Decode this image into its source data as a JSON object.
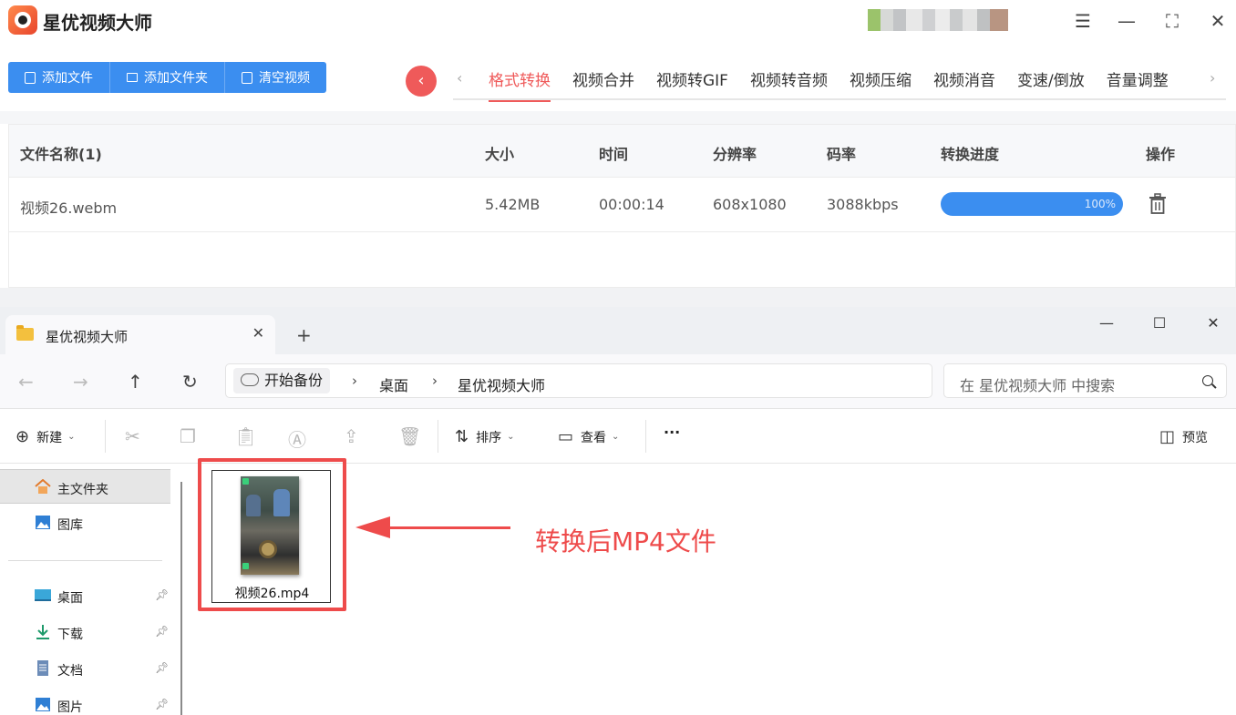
{
  "app": {
    "title": "星优视频大师",
    "window_controls": {
      "menu": "☰",
      "minimize": "—",
      "maximize": "⛶",
      "close": "✕"
    },
    "toolbar": {
      "add_file": "添加文件",
      "add_folder": "添加文件夹",
      "clear": "清空视频"
    },
    "back_glyph": "‹",
    "tabs": [
      {
        "label": "格式转换",
        "active": true
      },
      {
        "label": "视频合并"
      },
      {
        "label": "视频转GIF"
      },
      {
        "label": "视频转音频"
      },
      {
        "label": "视频压缩"
      },
      {
        "label": "视频消音"
      },
      {
        "label": "变速/倒放"
      },
      {
        "label": "音量调整"
      }
    ],
    "table": {
      "headers": [
        "文件名称(1)",
        "大小",
        "时间",
        "分辨率",
        "码率",
        "转换进度",
        "操作"
      ],
      "rows": [
        {
          "name": "视频26.webm",
          "size": "5.42MB",
          "duration": "00:00:14",
          "resolution": "608x1080",
          "bitrate": "3088kbps",
          "progress": 100,
          "progress_label": "100%"
        }
      ]
    },
    "colors": {
      "accent": "#3b8ef0",
      "active_tab": "#ef5a5a"
    }
  },
  "explorer": {
    "tab_title": "星优视频大师",
    "tab_close": "✕",
    "new_tab": "+",
    "window_controls": {
      "minimize": "—",
      "maximize": "☐",
      "close": "✕"
    },
    "address": {
      "root": "开始备份",
      "crumbs": [
        "桌面",
        "星优视频大师"
      ],
      "separator": "›"
    },
    "search_placeholder": "在 星优视频大师 中搜索",
    "commands": {
      "new": "新建",
      "sort": "排序",
      "view": "查看",
      "more": "···",
      "preview": "预览"
    },
    "sidebar": [
      {
        "label": "主文件夹",
        "icon": "home-icon",
        "selected": true
      },
      {
        "label": "图库",
        "icon": "gallery-icon"
      },
      {
        "label": "桌面",
        "icon": "desktop-icon",
        "pinned": true
      },
      {
        "label": "下载",
        "icon": "download-icon",
        "pinned": true
      },
      {
        "label": "文档",
        "icon": "document-icon",
        "pinned": true
      },
      {
        "label": "图片",
        "icon": "pictures-icon",
        "pinned": true
      }
    ],
    "files": [
      {
        "name": "视频26.mp4"
      }
    ],
    "annotation": "转换后MP4文件",
    "annotation_color": "#ee4b4b"
  }
}
